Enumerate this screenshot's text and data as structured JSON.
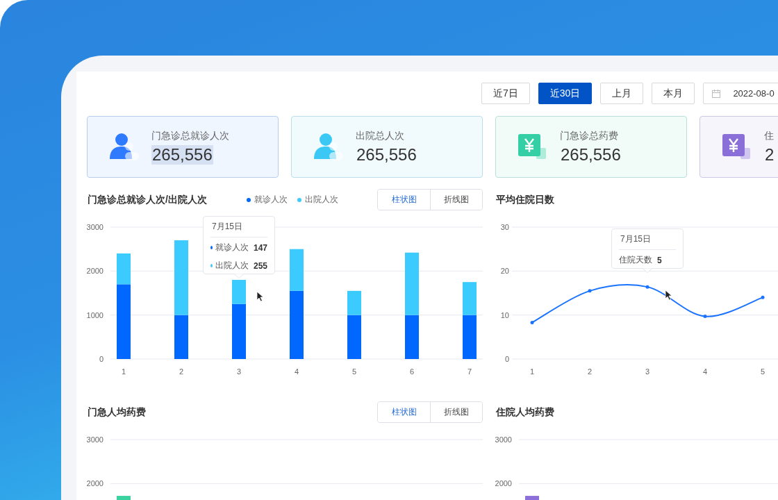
{
  "filters": [
    {
      "label": "近7日",
      "selected": false
    },
    {
      "label": "近30日",
      "selected": true
    },
    {
      "label": "上月",
      "selected": false
    },
    {
      "label": "本月",
      "selected": false
    }
  ],
  "date_range": {
    "value": "2022-08-0"
  },
  "stats": [
    {
      "label": "门急诊总就诊人次",
      "value": "265,556",
      "kind": "person",
      "color": "#2f7bff",
      "highlighted": true
    },
    {
      "label": "出院总人次",
      "value": "265,556",
      "kind": "person",
      "color": "#3cc8f5",
      "highlighted": false
    },
    {
      "label": "门急诊总药费",
      "value": "265,556",
      "kind": "yen",
      "color": "#34cfa5",
      "highlighted": false
    },
    {
      "label": "住",
      "value": "2",
      "kind": "yen",
      "color": "#8a6fd8",
      "highlighted": false
    }
  ],
  "charts": [
    {
      "title": "门急诊总就诊人次/出院人次",
      "toggle": [
        {
          "label": "柱状图",
          "selected": true
        },
        {
          "label": "折线图",
          "selected": false
        }
      ],
      "chart_data": {
        "type": "bar",
        "stacked": true,
        "categories": [
          "1",
          "2",
          "3",
          "4",
          "5",
          "6",
          "7"
        ],
        "yticks": [
          0,
          1000,
          2000,
          3000
        ],
        "ylim": [
          0,
          3000
        ],
        "series": [
          {
            "name": "就诊人次",
            "color": "#0068ff",
            "values": [
              1700,
              1000,
              1250,
              1550,
              1000,
              1000,
              1000
            ]
          },
          {
            "name": "出院人次",
            "color": "#3ccbff",
            "values": [
              700,
              1700,
              550,
              950,
              550,
              1420,
              750
            ]
          }
        ]
      },
      "hovered": [
        false,
        false,
        true,
        false,
        false,
        false,
        false
      ],
      "tooltip": {
        "title": "7月15日",
        "rows": [
          {
            "label": "就诊人次",
            "value": "147",
            "color": "#0068ff"
          },
          {
            "label": "出院人次",
            "value": "255",
            "color": "#3ccbff"
          }
        ]
      }
    },
    {
      "title": "平均住院日数",
      "chart_data": {
        "type": "line",
        "categories": [
          "1",
          "2",
          "3",
          "4",
          "5"
        ],
        "yticks": [
          0,
          10,
          20,
          30
        ],
        "ylim": [
          0,
          30
        ],
        "series": [
          {
            "color": "#1a73ff",
            "values": [
              8.3,
              15.5,
              16.4,
              9.7,
              14
            ]
          }
        ]
      },
      "hovered": [
        false,
        false,
        true,
        false,
        false
      ],
      "tooltip": {
        "title": "7月15日",
        "rows": [
          {
            "label": "住院天数",
            "value": "5"
          }
        ]
      }
    },
    {
      "title": "门急人均药费",
      "toggle": [
        {
          "label": "柱状图",
          "selected": true
        },
        {
          "label": "折线图",
          "selected": false
        }
      ],
      "chart_data": {
        "type": "bar",
        "yticks": [
          2000,
          3000
        ],
        "ylim": [
          0,
          3000
        ],
        "series": [
          {
            "color": "#3ad29f",
            "values": [
              1720
            ]
          }
        ]
      }
    },
    {
      "title": "住院人均药费",
      "chart_data": {
        "type": "bar",
        "yticks": [
          2000,
          3000
        ],
        "ylim": [
          0,
          3000
        ],
        "series": [
          {
            "color": "#8c6fd9",
            "values": [
              1720
            ]
          }
        ]
      }
    }
  ]
}
